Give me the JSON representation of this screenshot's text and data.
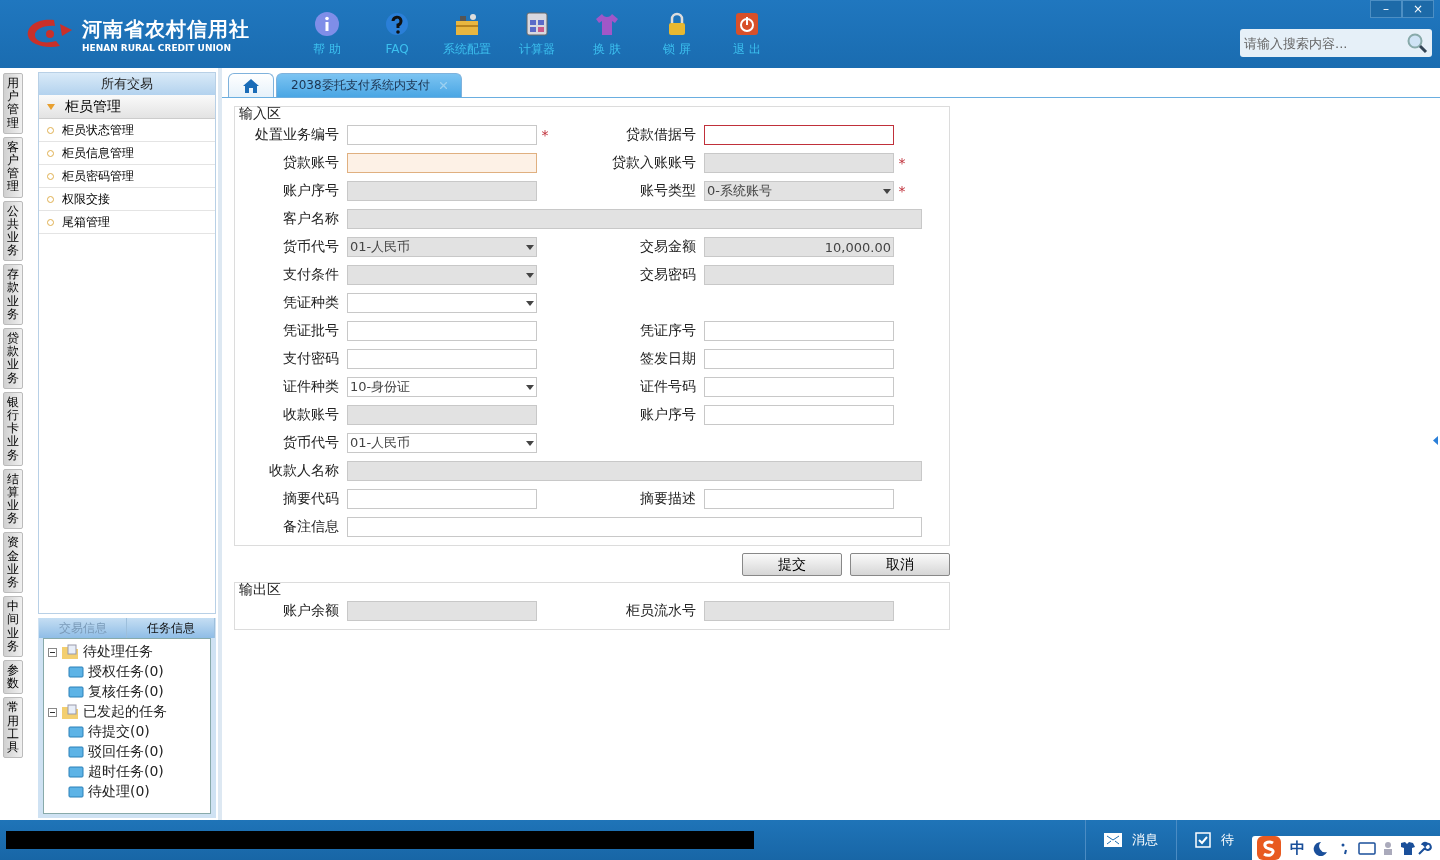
{
  "header": {
    "logo_title": "河南省农村信用社",
    "logo_subtitle": "HENAN RURAL CREDIT UNION",
    "toolbar": [
      {
        "label": "帮 助",
        "kind": "info"
      },
      {
        "label": "FAQ",
        "kind": "help"
      },
      {
        "label": "系统配置",
        "kind": "tools"
      },
      {
        "label": "计算器",
        "kind": "calculator"
      },
      {
        "label": "换 肤",
        "kind": "shirt"
      },
      {
        "label": "锁 屏",
        "kind": "lock"
      },
      {
        "label": "退 出",
        "kind": "power"
      }
    ],
    "search": {
      "placeholder": "请输入搜索内容..."
    },
    "window_buttons": [
      "–",
      "×"
    ]
  },
  "side_tabs": [
    "用户管理",
    "客户管理",
    "公共业务",
    "存款业务",
    "贷款业务",
    "银行卡业务",
    "结算业务",
    "资金业务",
    "中间业务",
    "参数",
    "常用工具"
  ],
  "sidebar": {
    "title": "所有交易",
    "group": {
      "label": "柜员管理",
      "expanded": true,
      "items": [
        "柜员状态管理",
        "柜员信息管理",
        "柜员密码管理",
        "权限交接",
        "尾箱管理"
      ]
    },
    "bottom_tabs": [
      {
        "label": "交易信息",
        "selected": false
      },
      {
        "label": "任务信息",
        "selected": true
      }
    ],
    "tree": [
      {
        "label": "待处理任务",
        "expanded": true,
        "children": [
          {
            "label": "授权任务(0)"
          },
          {
            "label": "复核任务(0)"
          }
        ]
      },
      {
        "label": "已发起的任务",
        "expanded": true,
        "children": [
          {
            "label": "待提交(0)"
          },
          {
            "label": "驳回任务(0)"
          },
          {
            "label": "超时任务(0)"
          },
          {
            "label": "待处理(0)"
          }
        ]
      }
    ]
  },
  "tabs": [
    {
      "kind": "home",
      "selected": false
    },
    {
      "kind": "page",
      "label": "2038委托支付系统内支付",
      "selected": true
    }
  ],
  "input_section": {
    "title": "输入区",
    "rows": [
      {
        "fields": [
          {
            "label": "处置业务编号",
            "kind": "text",
            "disabled": false,
            "full": false,
            "invalid": false,
            "highlighted": false,
            "marker": "*"
          },
          {
            "label": "贷款借据号",
            "kind": "text",
            "disabled": false,
            "full": false,
            "invalid": true,
            "highlighted": false
          }
        ]
      },
      {
        "fields": [
          {
            "label": "贷款账号",
            "kind": "text",
            "disabled": false,
            "full": false,
            "invalid": false,
            "highlighted": true
          },
          {
            "label": "贷款入账账号",
            "kind": "text",
            "disabled": true,
            "full": false,
            "invalid": false,
            "highlighted": false,
            "marker": "*"
          }
        ]
      },
      {
        "fields": [
          {
            "label": "账户序号",
            "kind": "text",
            "disabled": true,
            "full": false,
            "invalid": false,
            "highlighted": false
          },
          {
            "label": "账号类型",
            "kind": "select",
            "value": "0-系统账号",
            "disabled": true,
            "full": false,
            "invalid": false,
            "highlighted": false,
            "marker": "*"
          }
        ]
      },
      {
        "fields": [
          {
            "label": "客户名称",
            "kind": "text",
            "disabled": true,
            "full": true,
            "invalid": false,
            "highlighted": false
          }
        ]
      },
      {
        "fields": [
          {
            "label": "货币代号",
            "kind": "select",
            "value": "01-人民币",
            "disabled": true,
            "full": false,
            "invalid": false,
            "highlighted": false
          },
          {
            "label": "交易金额",
            "kind": "text",
            "value": "10,000.00",
            "disabled": true,
            "full": false,
            "invalid": false,
            "highlighted": false
          }
        ]
      },
      {
        "fields": [
          {
            "label": "支付条件",
            "kind": "select",
            "disabled": true,
            "full": false,
            "invalid": false,
            "highlighted": false
          },
          {
            "label": "交易密码",
            "kind": "text",
            "disabled": true,
            "full": false,
            "invalid": false,
            "highlighted": false
          }
        ]
      },
      {
        "fields": [
          {
            "label": "凭证种类",
            "kind": "select",
            "disabled": false,
            "full": false,
            "invalid": false,
            "highlighted": false
          }
        ]
      },
      {
        "fields": [
          {
            "label": "凭证批号",
            "kind": "text",
            "disabled": false,
            "full": false,
            "invalid": false,
            "highlighted": false
          },
          {
            "label": "凭证序号",
            "kind": "text",
            "disabled": false,
            "full": false,
            "invalid": false,
            "highlighted": false
          }
        ]
      },
      {
        "fields": [
          {
            "label": "支付密码",
            "kind": "text",
            "disabled": false,
            "full": false,
            "invalid": false,
            "highlighted": false
          },
          {
            "label": "签发日期",
            "kind": "text",
            "disabled": false,
            "full": false,
            "invalid": false,
            "highlighted": false
          }
        ]
      },
      {
        "fields": [
          {
            "label": "证件种类",
            "kind": "select",
            "value": "10-身份证",
            "disabled": false,
            "full": false,
            "invalid": false,
            "highlighted": false
          },
          {
            "label": "证件号码",
            "kind": "text",
            "disabled": false,
            "full": false,
            "invalid": false,
            "highlighted": false
          }
        ]
      },
      {
        "fields": [
          {
            "label": "收款账号",
            "kind": "text",
            "disabled": true,
            "full": false,
            "invalid": false,
            "highlighted": false
          },
          {
            "label": "账户序号",
            "kind": "text",
            "disabled": false,
            "full": false,
            "invalid": false,
            "highlighted": false
          }
        ]
      },
      {
        "fields": [
          {
            "label": "货币代号",
            "kind": "select",
            "value": "01-人民币",
            "disabled": false,
            "full": false,
            "invalid": false,
            "highlighted": false
          }
        ]
      },
      {
        "fields": [
          {
            "label": "收款人名称",
            "kind": "text",
            "disabled": true,
            "full": true,
            "invalid": false,
            "highlighted": false
          }
        ]
      },
      {
        "fields": [
          {
            "label": "摘要代码",
            "kind": "text",
            "disabled": false,
            "full": false,
            "invalid": false,
            "highlighted": false
          },
          {
            "label": "摘要描述",
            "kind": "text",
            "disabled": false,
            "full": false,
            "invalid": false,
            "highlighted": false
          }
        ]
      },
      {
        "fields": [
          {
            "label": "备注信息",
            "kind": "text",
            "disabled": false,
            "full": true,
            "invalid": false,
            "highlighted": false
          }
        ]
      }
    ]
  },
  "buttons": [
    "提交",
    "取消"
  ],
  "output_section": {
    "title": "输出区",
    "rows": [
      {
        "fields": [
          {
            "label": "账户余额",
            "disabled": true
          },
          {
            "label": "柜员流水号",
            "disabled": true
          }
        ]
      }
    ]
  },
  "status_bar": {
    "items": [
      {
        "kind": "message",
        "label": "消息"
      },
      {
        "kind": "todo",
        "label": "待"
      }
    ],
    "ime": {
      "label": "中"
    }
  }
}
